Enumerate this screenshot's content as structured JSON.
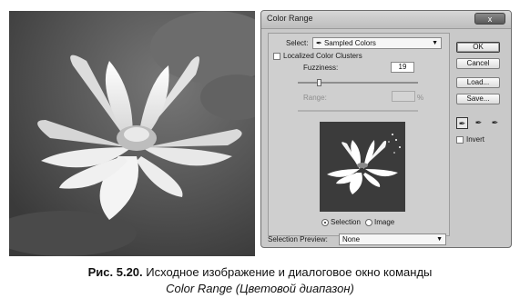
{
  "dialog": {
    "title": "Color Range",
    "close_label": "x",
    "select_label": "Select:",
    "select_icon": "eyedropper-icon",
    "select_value": "Sampled Colors",
    "localized_clusters_label": "Localized Color Clusters",
    "localized_clusters_checked": false,
    "fuzziness_label": "Fuzziness:",
    "fuzziness_value": "19",
    "range_label": "Range:",
    "range_value": "",
    "range_unit": "%",
    "preview_mode_selection_label": "Selection",
    "preview_mode_image_label": "Image",
    "preview_mode_selected": "Selection",
    "selection_preview_label": "Selection Preview:",
    "selection_preview_value": "None",
    "buttons": {
      "ok": "OK",
      "cancel": "Cancel",
      "load": "Load...",
      "save": "Save..."
    },
    "eyedroppers": [
      "eyedropper-icon",
      "eyedropper-plus-icon",
      "eyedropper-minus-icon"
    ],
    "invert_label": "Invert",
    "invert_checked": false
  },
  "caption": {
    "label": "Рис. 5.20.",
    "line1": "Исходное изображение и диалоговое окно команды",
    "line2": "Color Range (Цветовой диапазон)"
  }
}
